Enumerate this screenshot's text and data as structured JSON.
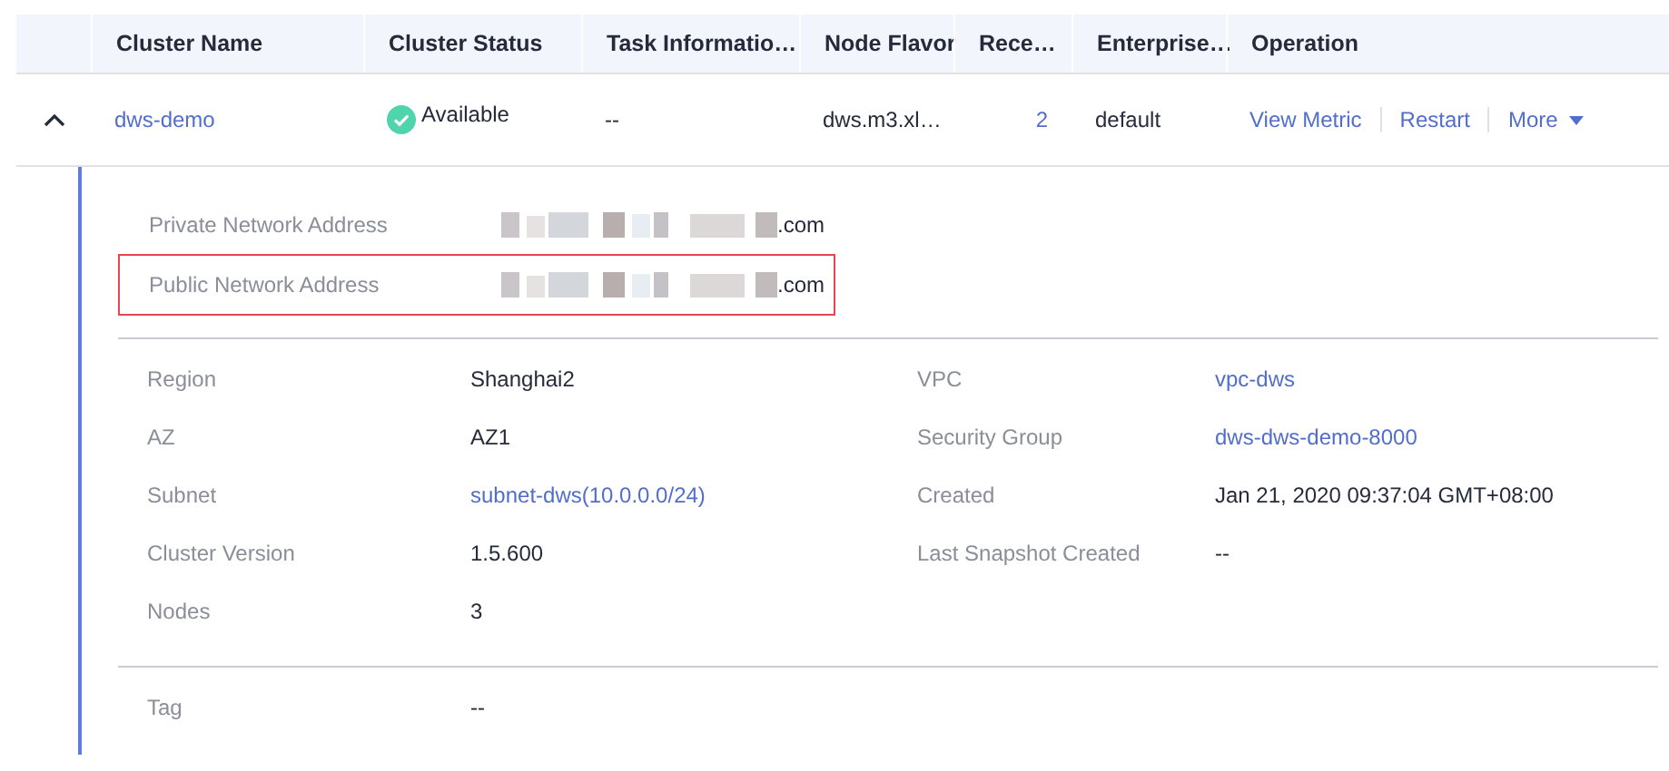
{
  "table": {
    "columns": [
      "Cluster Name",
      "Cluster Status",
      "Task Informatio…",
      "Node Flavor",
      "Rece…",
      "Enterprise…",
      "Operation"
    ],
    "rows": [
      {
        "expanded": true,
        "name": "dws-demo",
        "status": {
          "kind": "available",
          "text": "Available"
        },
        "task": "--",
        "node_flavor": "dws.m3.xl…",
        "recent": "2",
        "enterprise": "default",
        "operations": [
          {
            "label": "View Metric",
            "kind": "link"
          },
          {
            "label": "Restart",
            "kind": "link"
          },
          {
            "label": "More",
            "kind": "dropdown"
          }
        ],
        "details": {
          "addresses": [
            {
              "label": "Private Network Address",
              "value": ".com",
              "highlighted": false
            },
            {
              "label": "Public Network Address",
              "value": ".com",
              "highlighted": true
            }
          ],
          "properties": [
            {
              "label": "Region",
              "value": "Shanghai2",
              "link": false
            },
            {
              "label": "VPC",
              "value": "vpc-dws",
              "link": true
            },
            {
              "label": "AZ",
              "value": "AZ1",
              "link": false
            },
            {
              "label": "Security Group",
              "value": "dws-dws-demo-8000",
              "link": true
            },
            {
              "label": "Subnet",
              "value": "subnet-dws(10.0.0.0/24)",
              "link": true
            },
            {
              "label": "Created",
              "value": "Jan 21, 2020 09:37:04 GMT+08:00",
              "link": false
            },
            {
              "label": "Cluster Version",
              "value": "1.5.600",
              "link": false
            },
            {
              "label": "Last Snapshot Created",
              "value": "--",
              "link": false
            },
            {
              "label": "Nodes",
              "value": "3",
              "link": false
            }
          ],
          "tags": [
            {
              "label": "Tag",
              "value": "--"
            }
          ]
        }
      }
    ]
  }
}
